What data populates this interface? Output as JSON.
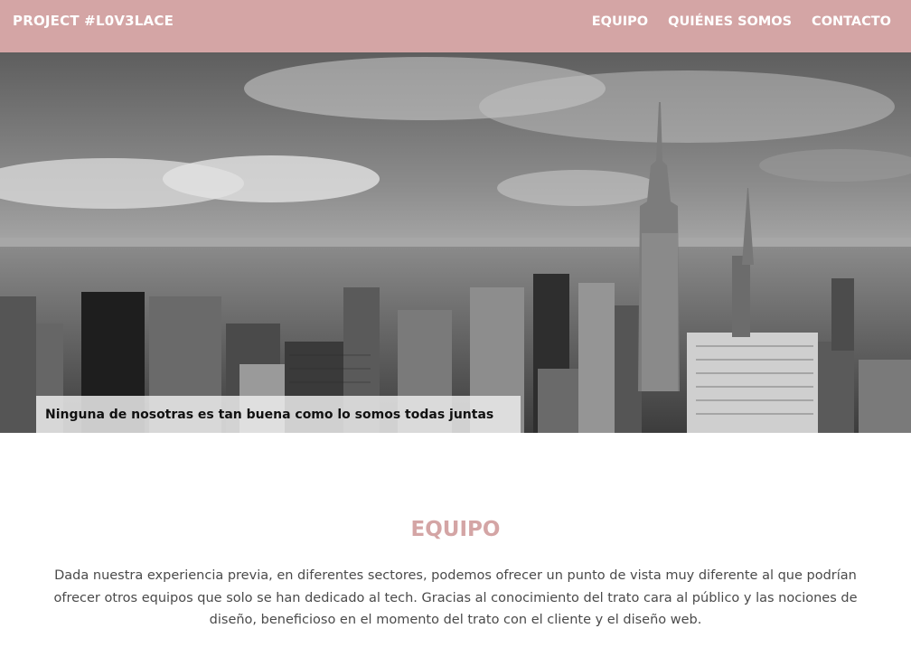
{
  "nav": {
    "brand": "PROJECT #L0V3LACE",
    "links": [
      "EQUIPO",
      "QUIÉNES SOMOS",
      "CONTACTO"
    ]
  },
  "hero": {
    "image": "grayscale-city-skyline",
    "caption": "Ninguna de nosotras es tan buena como lo somos todas juntas"
  },
  "team_section": {
    "title": "EQUIPO",
    "text": "Dada nuestra experiencia previa, en diferentes sectores, podemos ofrecer un punto de vista muy diferente al que podrían ofrecer otros equipos que solo se han dedicado al tech. Gracias al conocimiento del trato cara al público y las nociones de diseño, beneficioso en el momento del trato con el cliente y el diseño web."
  },
  "colors": {
    "nav_background": "#d4a5a5",
    "accent": "#d4a5a5"
  }
}
